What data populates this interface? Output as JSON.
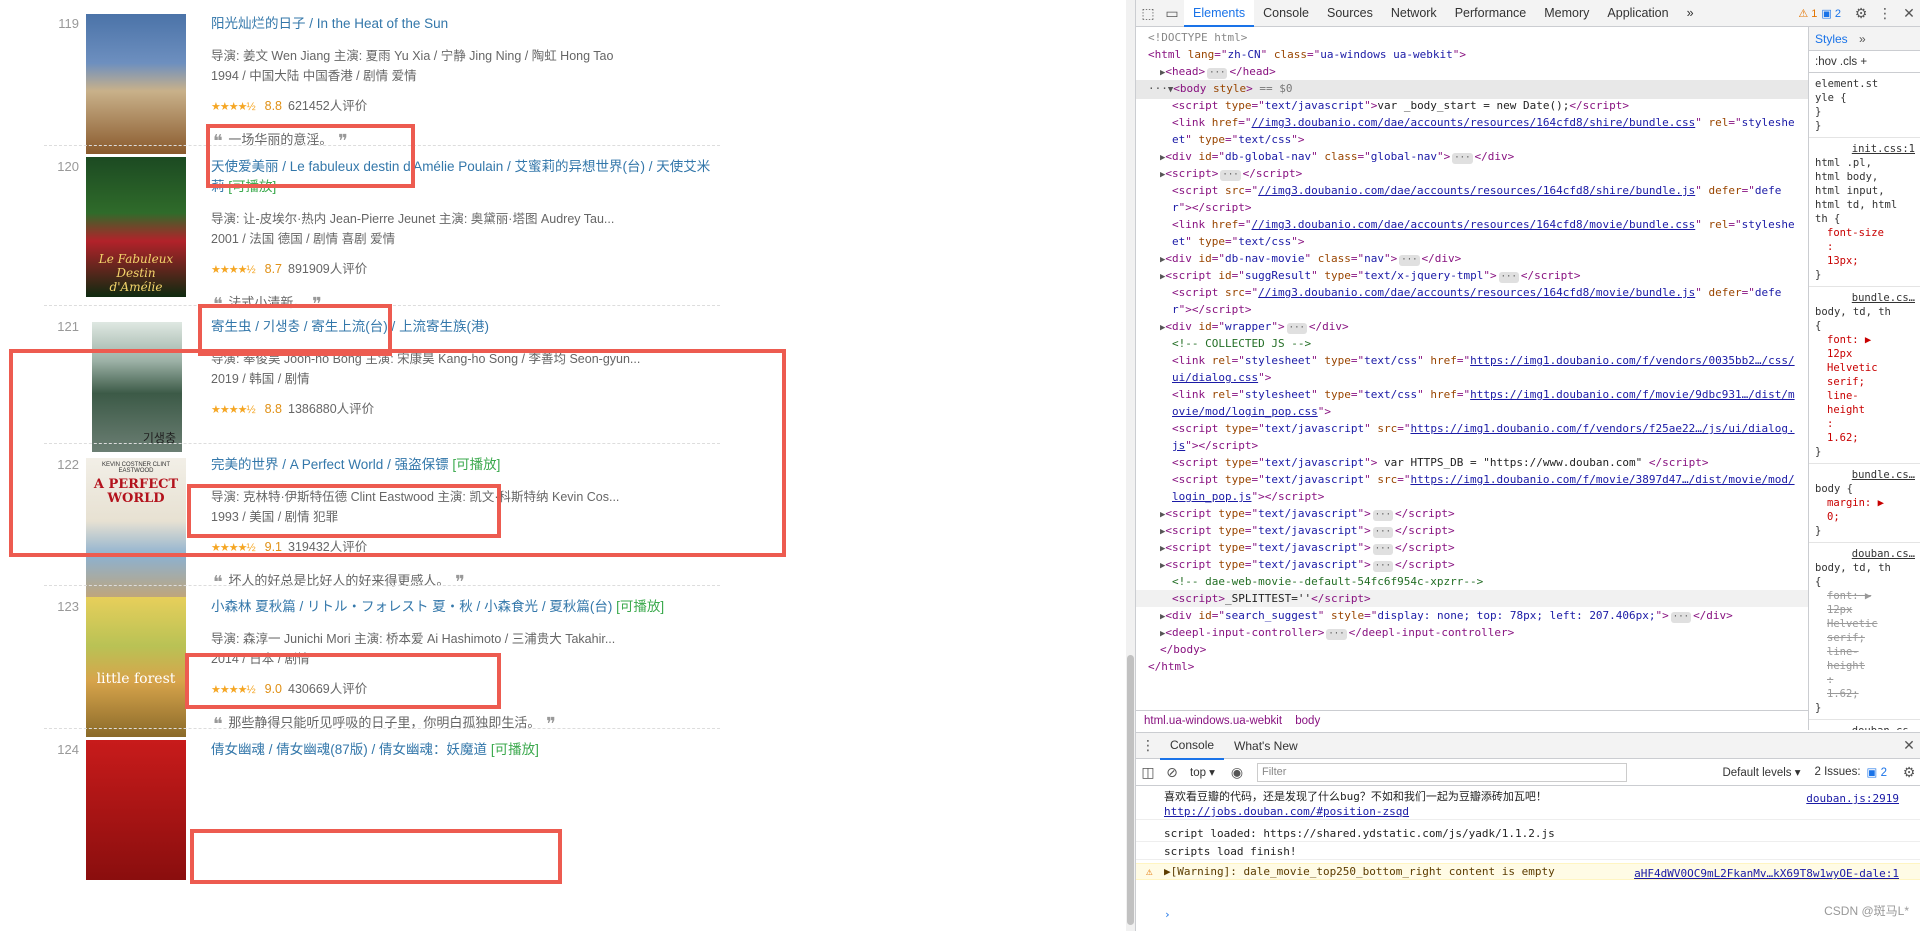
{
  "movies": [
    {
      "rank": "119",
      "title_parts": [
        "阳光灿烂的日子",
        "In the Heat of the Sun"
      ],
      "playable": "",
      "crew": "导演: 姜文 Wen Jiang   主演: 夏雨 Yu Xia / 宁静 Jing Ning / 陶虹 Hong Tao",
      "meta": "1994 / 中国大陆 中国香港 / 剧情 爱情",
      "stars": "★★★★½",
      "score": "8.8",
      "votes": "621452人评价",
      "quote": "一场华丽的意淫。"
    },
    {
      "rank": "120",
      "title_parts": [
        "天使爱美丽",
        "Le fabuleux destin d'Amélie Poulain",
        "艾蜜莉的异想世界(台)",
        "天使艾米莉"
      ],
      "playable": "[可播放]",
      "crew": "导演: 让-皮埃尔·热内 Jean-Pierre Jeunet   主演: 奥黛丽·塔图 Audrey Tau...",
      "meta": "2001 / 法国 德国 / 剧情 喜剧 爱情",
      "stars": "★★★★½",
      "score": "8.7",
      "votes": "891909人评价",
      "quote": "法式小清新。"
    },
    {
      "rank": "121",
      "title_parts": [
        "寄生虫",
        "기생충",
        "寄生上流(台)",
        "上流寄生族(港)"
      ],
      "playable": "",
      "crew": "导演: 奉俊昊 Joon-ho Bong   主演: 宋康昊 Kang-ho Song / 李善均 Seon-gyun...",
      "meta": "2019 / 韩国 / 剧情",
      "stars": "★★★★½",
      "score": "8.8",
      "votes": "1386880人评价",
      "quote": ""
    },
    {
      "rank": "122",
      "title_parts": [
        "完美的世界",
        "A Perfect World",
        "强盗保镖"
      ],
      "playable": "[可播放]",
      "crew": "导演: 克林特·伊斯特伍德 Clint Eastwood   主演: 凯文·科斯特纳 Kevin Cos...",
      "meta": "1993 / 美国 / 剧情 犯罪",
      "stars": "★★★★½",
      "score": "9.1",
      "votes": "319432人评价",
      "quote": "坏人的好总是比好人的好来得更感人。"
    },
    {
      "rank": "123",
      "title_parts": [
        "小森林 夏秋篇",
        "リトル・フォレスト 夏・秋",
        "小森食光",
        "夏秋篇(台)"
      ],
      "playable": "[可播放]",
      "crew": "导演: 森淳一 Junichi Mori   主演: 桥本爱 Ai Hashimoto / 三浦贵大 Takahir...",
      "meta": "2014 / 日本 / 剧情",
      "stars": "★★★★½",
      "score": "9.0",
      "votes": "430669人评价",
      "quote": "那些静得只能听见呼吸的日子里，你明白孤独即生活。"
    },
    {
      "rank": "124",
      "title_parts": [
        "倩女幽魂",
        "倩女幽魂(87版)",
        "倩女幽魂：妖魔道"
      ],
      "playable": "[可播放]",
      "crew": "",
      "meta": "",
      "stars": "",
      "score": "",
      "votes": "",
      "quote": ""
    }
  ],
  "posters": {
    "p120_text": "Le Fabuleux Destin d'Amélie",
    "p121_text": "기생충",
    "p122_top": "KEVIN COSTNER   CLINT EASTWOOD",
    "p122_title": "A PERFECT WORLD",
    "p123_text": "little forest"
  },
  "devtools": {
    "tabs": [
      "Elements",
      "Console",
      "Sources",
      "Network",
      "Performance",
      "Memory",
      "Application"
    ],
    "more": "»",
    "warn_count": "1",
    "info_count": "2",
    "dom_lines": [
      {
        "indent": 0,
        "html": "<span class='txt' style='color:#888'>&lt;!DOCTYPE html&gt;</span>"
      },
      {
        "indent": 0,
        "html": "&lt;html <span class='attr'>lang</span>=\"<span class='aval'>zh-CN</span>\" <span class='attr'>class</span>=\"<span class='aval'>ua-windows ua-webkit</span>\"&gt;"
      },
      {
        "indent": 1,
        "html": "<span class='arrow'>▶</span>&lt;head&gt;<span class='ellip'>···</span>&lt;/head&gt;"
      },
      {
        "indent": 0,
        "sel": true,
        "html": "<span style='color:#555'>···</span><span class='arrow'>▼</span>&lt;body <span class='attr'>style</span>&gt; <span style='color:#777'>== $0</span>"
      },
      {
        "indent": 2,
        "html": "&lt;script <span class='attr'>type</span>=\"<span class='aval'>text/javascript</span>\"&gt;<span class='txt'>var _body_start = new Date();</span>&lt;/script&gt;"
      },
      {
        "indent": 2,
        "html": "&lt;link <span class='attr'>href</span>=\"<span class='link'>//img3.doubanio.com/dae/accounts/resources/164cfd8/shire/bundle.css</span>\" <span class='attr'>rel</span>=\"<span class='aval'>styleshe</span>"
      },
      {
        "indent": 2,
        "html": "<span class='aval'>et</span>\" <span class='attr'>type</span>=\"<span class='aval'>text/css</span>\"&gt;"
      },
      {
        "indent": 1,
        "html": "<span class='arrow'>▶</span>&lt;div <span class='attr'>id</span>=\"<span class='aval'>db-global-nav</span>\" <span class='attr'>class</span>=\"<span class='aval'>global-nav</span>\"&gt;<span class='ellip'>···</span>&lt;/div&gt;"
      },
      {
        "indent": 1,
        "html": "<span class='arrow'>▶</span>&lt;script&gt;<span class='ellip'>···</span>&lt;/script&gt;"
      },
      {
        "indent": 2,
        "html": "&lt;script <span class='attr'>src</span>=\"<span class='link'>//img3.doubanio.com/dae/accounts/resources/164cfd8/shire/bundle.js</span>\" <span class='attr'>defer</span>=\"<span class='aval'>defe</span>"
      },
      {
        "indent": 2,
        "html": "<span class='aval'>r</span>\"&gt;&lt;/script&gt;"
      },
      {
        "indent": 2,
        "html": "&lt;link <span class='attr'>href</span>=\"<span class='link'>//img3.doubanio.com/dae/accounts/resources/164cfd8/movie/bundle.css</span>\" <span class='attr'>rel</span>=\"<span class='aval'>styleshe</span>"
      },
      {
        "indent": 2,
        "html": "<span class='aval'>et</span>\" <span class='attr'>type</span>=\"<span class='aval'>text/css</span>\"&gt;"
      },
      {
        "indent": 1,
        "html": "<span class='arrow'>▶</span>&lt;div <span class='attr'>id</span>=\"<span class='aval'>db-nav-movie</span>\" <span class='attr'>class</span>=\"<span class='aval'>nav</span>\"&gt;<span class='ellip'>···</span>&lt;/div&gt;"
      },
      {
        "indent": 1,
        "html": "<span class='arrow'>▶</span>&lt;script <span class='attr'>id</span>=\"<span class='aval'>suggResult</span>\" <span class='attr'>type</span>=\"<span class='aval'>text/x-jquery-tmpl</span>\"&gt;<span class='ellip'>···</span>&lt;/script&gt;"
      },
      {
        "indent": 2,
        "html": "&lt;script <span class='attr'>src</span>=\"<span class='link'>//img3.doubanio.com/dae/accounts/resources/164cfd8/movie/bundle.js</span>\" <span class='attr'>defer</span>=\"<span class='aval'>defe</span>"
      },
      {
        "indent": 2,
        "html": "<span class='aval'>r</span>\"&gt;&lt;/script&gt;"
      },
      {
        "indent": 1,
        "html": "<span class='arrow'>▶</span>&lt;div <span class='attr'>id</span>=\"<span class='aval'>wrapper</span>\"&gt;<span class='ellip'>···</span>&lt;/div&gt;"
      },
      {
        "indent": 2,
        "html": "<span class='cm'>&lt;!-- COLLECTED JS --&gt;</span>"
      },
      {
        "indent": 2,
        "html": "&lt;link <span class='attr'>rel</span>=\"<span class='aval'>stylesheet</span>\" <span class='attr'>type</span>=\"<span class='aval'>text/css</span>\" <span class='attr'>href</span>=\"<span class='link'>https://img1.doubanio.com/f/vendors/0035bb2…/css/</span>"
      },
      {
        "indent": 2,
        "html": "<span class='link'>ui/dialog.css</span>\"&gt;"
      },
      {
        "indent": 2,
        "html": "&lt;link <span class='attr'>rel</span>=\"<span class='aval'>stylesheet</span>\" <span class='attr'>type</span>=\"<span class='aval'>text/css</span>\" <span class='attr'>href</span>=\"<span class='link'>https://img1.doubanio.com/f/movie/9dbc931…/dist/m</span>"
      },
      {
        "indent": 2,
        "html": "<span class='link'>ovie/mod/login_pop.css</span>\"&gt;"
      },
      {
        "indent": 2,
        "html": "&lt;script <span class='attr'>type</span>=\"<span class='aval'>text/javascript</span>\" <span class='attr'>src</span>=\"<span class='link'>https://img1.doubanio.com/f/vendors/f25ae22…/js/ui/dialog.</span>"
      },
      {
        "indent": 2,
        "html": "<span class='link'>js</span>\"&gt;&lt;/script&gt;"
      },
      {
        "indent": 2,
        "html": "&lt;script <span class='attr'>type</span>=\"<span class='aval'>text/javascript</span>\"&gt;<span class='txt'> var HTTPS_DB = \"https://www.douban.com\" </span>&lt;/script&gt;"
      },
      {
        "indent": 2,
        "html": "&lt;script <span class='attr'>type</span>=\"<span class='aval'>text/javascript</span>\" <span class='attr'>src</span>=\"<span class='link'>https://img1.doubanio.com/f/movie/3897d47…/dist/movie/mod/</span>"
      },
      {
        "indent": 2,
        "html": "<span class='link'>login_pop.js</span>\"&gt;&lt;/script&gt;"
      },
      {
        "indent": 1,
        "html": "<span class='arrow'>▶</span>&lt;script <span class='attr'>type</span>=\"<span class='aval'>text/javascript</span>\"&gt;<span class='ellip'>···</span>&lt;/script&gt;"
      },
      {
        "indent": 1,
        "html": "<span class='arrow'>▶</span>&lt;script <span class='attr'>type</span>=\"<span class='aval'>text/javascript</span>\"&gt;<span class='ellip'>···</span>&lt;/script&gt;"
      },
      {
        "indent": 1,
        "html": "<span class='arrow'>▶</span>&lt;script <span class='attr'>type</span>=\"<span class='aval'>text/javascript</span>\"&gt;<span class='ellip'>···</span>&lt;/script&gt;"
      },
      {
        "indent": 1,
        "html": "<span class='arrow'>▶</span>&lt;script <span class='attr'>type</span>=\"<span class='aval'>text/javascript</span>\"&gt;<span class='ellip'>···</span>&lt;/script&gt;"
      },
      {
        "indent": 2,
        "html": "<span class='cm'>&lt;!-- dae-web-movie--default-54fc6f954c-xpzrr--&gt;</span>"
      },
      {
        "indent": 2,
        "sel2": true,
        "html": "&lt;script&gt;<span class='txt'>_SPLITTEST=''</span>&lt;/script&gt;"
      },
      {
        "indent": 1,
        "html": "<span class='arrow'>▶</span>&lt;div <span class='attr'>id</span>=\"<span class='aval'>search_suggest</span>\" <span class='attr'>style</span>=\"<span class='aval'>display: none; top: 78px; left: 207.406px;</span>\"&gt;<span class='ellip'>···</span>&lt;/div&gt;"
      },
      {
        "indent": 1,
        "html": "<span class='arrow'>▶</span>&lt;deepl-input-controller&gt;<span class='ellip'>···</span>&lt;/deepl-input-controller&gt;"
      },
      {
        "indent": 1,
        "html": "&lt;/body&gt;"
      },
      {
        "indent": 0,
        "html": "&lt;/html&gt;"
      }
    ],
    "breadcrumb": [
      "html.ua-windows.ua-webkit",
      "body"
    ],
    "styles_tabs": [
      "Styles",
      "»"
    ],
    "styles_filter": ":hov  .cls  +",
    "styles_blocks": [
      {
        "src": "",
        "lines": [
          "element.st",
          "yle {",
          "}"
        ]
      },
      {
        "src": "init.css:1",
        "lines": [
          "html .pl,",
          "html body,",
          "html input,",
          "html td, html",
          "th {"
        ],
        "props": [
          "font-size",
          ":",
          "13px;"
        ]
      },
      {
        "src": "bundle.cs…",
        "lines": [
          "body, td, th",
          "{"
        ],
        "props": [
          "font: ▶",
          "12px",
          "Helvetic",
          "serif;",
          "line-",
          "height",
          ":",
          "1.62;"
        ]
      },
      {
        "src": "bundle.cs…",
        "lines": [
          "body {"
        ],
        "props": [
          "margin: ▶",
          "0;"
        ]
      },
      {
        "src": "douban.cs…",
        "lines": [
          "body, td, th",
          "{"
        ],
        "props": [
          "font: ▶",
          "12px",
          "Helvetic",
          "serif;",
          "line-",
          "height",
          ":",
          "1.62;"
        ],
        "strike": true
      },
      {
        "src": "douban.cs…",
        "lines": [],
        "props": []
      }
    ],
    "console": {
      "tabs": [
        "Console",
        "What's New"
      ],
      "context": "top ▾",
      "filter_placeholder": "Filter",
      "levels": "Default levels ▾",
      "issues": "2 Issues:",
      "issues_count": "2",
      "messages": [
        {
          "text": "喜欢看豆瓣的代码，还是发现了什么bug？不如和我们一起为豆瓣添砖加瓦吧！",
          "text2": "http://jobs.douban.com/#position-zsqd",
          "src": "douban.js:2919",
          "type": "log"
        },
        {
          "text": "script loaded:  https://shared.ydstatic.com/js/yadk/1.1.2.js",
          "text2": "",
          "src": "",
          "type": "log"
        },
        {
          "text": "scripts load finish!",
          "text2": "",
          "src": "",
          "type": "log"
        },
        {
          "text": "▶[Warning]: dale_movie_top250_bottom_right content is empty",
          "text2": "",
          "src": "aHF4dWV0OC9mL2FkanMv…kX69T8w1wyOE-dale:1",
          "type": "warn"
        }
      ],
      "prompt": "›"
    }
  },
  "watermark": "CSDN @斑马L*"
}
